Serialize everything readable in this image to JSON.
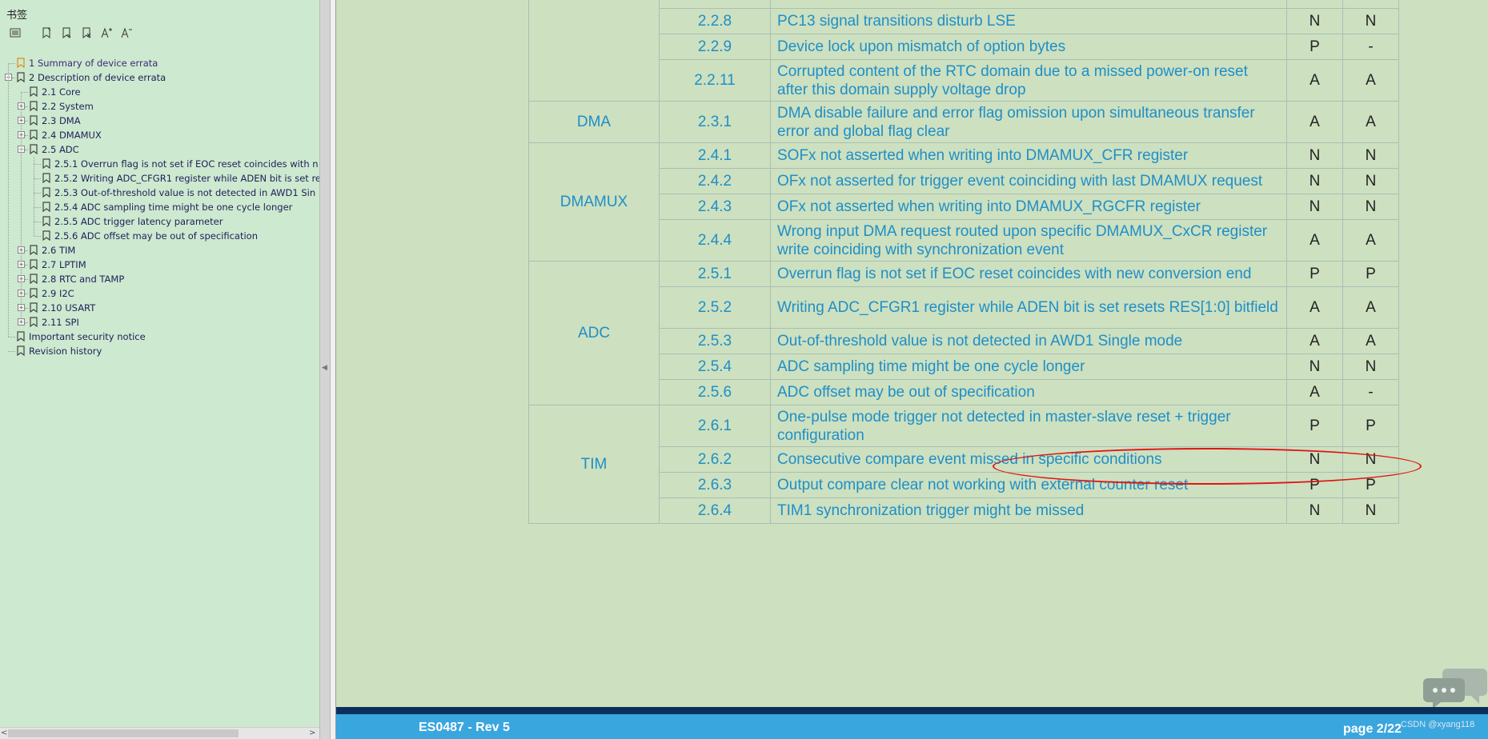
{
  "sidebar": {
    "title": "书签",
    "toolbar_icons": [
      "list-options-icon",
      "bookmark-add-icon",
      "bookmark-add-child-icon",
      "bookmark-delete-icon",
      "font-increase-icon",
      "font-decrease-icon"
    ],
    "items": [
      {
        "label": "1 Summary of device errata",
        "level": 0,
        "toggle": "",
        "highlight": true
      },
      {
        "label": "2 Description of device errata",
        "level": 0,
        "toggle": "−"
      },
      {
        "label": "2.1 Core",
        "level": 1,
        "toggle": ""
      },
      {
        "label": "2.2 System",
        "level": 1,
        "toggle": "+"
      },
      {
        "label": "2.3 DMA",
        "level": 1,
        "toggle": "+"
      },
      {
        "label": "2.4 DMAMUX",
        "level": 1,
        "toggle": "+"
      },
      {
        "label": "2.5 ADC",
        "level": 1,
        "toggle": "−"
      },
      {
        "label": "2.5.1 Overrun flag is not set if EOC reset coincides with n",
        "level": 2,
        "toggle": ""
      },
      {
        "label": "2.5.2 Writing ADC_CFGR1 register while ADEN bit is set re",
        "level": 2,
        "toggle": ""
      },
      {
        "label": "2.5.3 Out-of-threshold value is not detected in AWD1 Sin",
        "level": 2,
        "toggle": ""
      },
      {
        "label": "2.5.4 ADC sampling time might be one cycle longer",
        "level": 2,
        "toggle": ""
      },
      {
        "label": "2.5.5 ADC trigger latency parameter",
        "level": 2,
        "toggle": ""
      },
      {
        "label": "2.5.6 ADC offset may be out of specification",
        "level": 2,
        "toggle": ""
      },
      {
        "label": "2.6 TIM",
        "level": 1,
        "toggle": "+"
      },
      {
        "label": "2.7 LPTIM",
        "level": 1,
        "toggle": "+"
      },
      {
        "label": "2.8 RTC and TAMP",
        "level": 1,
        "toggle": "+"
      },
      {
        "label": "2.9 I2C",
        "level": 1,
        "toggle": "+"
      },
      {
        "label": "2.10 USART",
        "level": 1,
        "toggle": "+"
      },
      {
        "label": "2.11 SPI",
        "level": 1,
        "toggle": "+"
      },
      {
        "label": "Important security notice",
        "level": 0,
        "toggle": ""
      },
      {
        "label": "Revision history",
        "level": 0,
        "toggle": ""
      }
    ]
  },
  "scrollbar": {
    "left_arrow": "<",
    "right_arrow": ">"
  },
  "table": {
    "groups": [
      {
        "module": "",
        "rows": [
          {
            "num": "",
            "desc": "",
            "s1": "",
            "s2": "",
            "lines": 1,
            "partial": true
          },
          {
            "num": "2.2.8",
            "desc": "PC13 signal transitions disturb LSE",
            "s1": "N",
            "s2": "N",
            "lines": 1
          },
          {
            "num": "2.2.9",
            "desc": "Device lock upon mismatch of option bytes",
            "s1": "P",
            "s2": "-",
            "lines": 1
          },
          {
            "num": "2.2.11",
            "desc": "Corrupted content of the RTC domain due to a missed power-on reset after this domain supply voltage drop",
            "s1": "A",
            "s2": "A",
            "lines": 2
          }
        ]
      },
      {
        "module": "DMA",
        "rows": [
          {
            "num": "2.3.1",
            "desc": "DMA disable failure and error flag omission upon simultaneous transfer error and global flag clear",
            "s1": "A",
            "s2": "A",
            "lines": 2
          }
        ]
      },
      {
        "module": "DMAMUX",
        "rows": [
          {
            "num": "2.4.1",
            "desc": "SOFx not asserted when writing into DMAMUX_CFR register",
            "s1": "N",
            "s2": "N",
            "lines": 1
          },
          {
            "num": "2.4.2",
            "desc": "OFx not asserted for trigger event coinciding with last DMAMUX request",
            "s1": "N",
            "s2": "N",
            "lines": 1
          },
          {
            "num": "2.4.3",
            "desc": "OFx not asserted when writing into DMAMUX_RGCFR register",
            "s1": "N",
            "s2": "N",
            "lines": 1
          },
          {
            "num": "2.4.4",
            "desc": "Wrong input DMA request routed upon specific DMAMUX_CxCR register write coinciding with synchronization event",
            "s1": "A",
            "s2": "A",
            "lines": 2
          }
        ]
      },
      {
        "module": "ADC",
        "rows": [
          {
            "num": "2.5.1",
            "desc": "Overrun flag is not set if EOC reset coincides with new conversion end",
            "s1": "P",
            "s2": "P",
            "lines": 1
          },
          {
            "num": "2.5.2",
            "desc": "Writing ADC_CFGR1 register while ADEN bit is set resets RES[1:0] bitfield",
            "s1": "A",
            "s2": "A",
            "lines": 2
          },
          {
            "num": "2.5.3",
            "desc": "Out-of-threshold value is not detected in AWD1 Single mode",
            "s1": "A",
            "s2": "A",
            "lines": 1
          },
          {
            "num": "2.5.4",
            "desc": "ADC sampling time might be one cycle longer",
            "s1": "N",
            "s2": "N",
            "lines": 1
          },
          {
            "num": "2.5.6",
            "desc": "ADC offset may be out of specification",
            "s1": "A",
            "s2": "-",
            "lines": 1
          }
        ]
      },
      {
        "module": "TIM",
        "rows": [
          {
            "num": "2.6.1",
            "desc": "One-pulse mode trigger not detected in master-slave reset + trigger configuration",
            "s1": "P",
            "s2": "P",
            "lines": 2
          },
          {
            "num": "2.6.2",
            "desc": "Consecutive compare event missed in specific conditions",
            "s1": "N",
            "s2": "N",
            "lines": 1
          },
          {
            "num": "2.6.3",
            "desc": "Output compare clear not working with external counter reset",
            "s1": "P",
            "s2": "P",
            "lines": 1
          },
          {
            "num": "2.6.4",
            "desc": "TIM1 synchronization trigger might be missed",
            "s1": "N",
            "s2": "N",
            "lines": 1
          }
        ]
      }
    ]
  },
  "annotation": {
    "color": "#e01414",
    "target": "2.5.6"
  },
  "footer": {
    "doc_ref": "ES0487 - Rev 5",
    "page": "page 2/22",
    "watermark": "CSDN @xyang118"
  },
  "colors": {
    "text": "#1f8fc7",
    "page_bg": "#cde0c0",
    "sidebar_bg": "#cde9cf",
    "footer": "#3aa6de"
  }
}
